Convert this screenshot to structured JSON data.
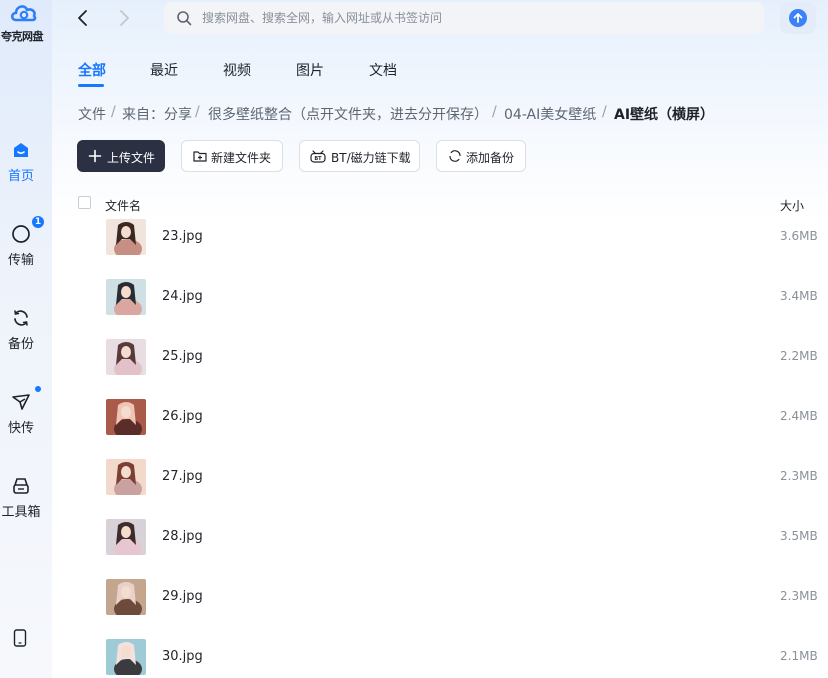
{
  "app": {
    "name": "夸克网盘"
  },
  "colors": {
    "accent": "#1677ff",
    "primary_button": "#2b3042"
  },
  "sidebar": {
    "items": [
      {
        "label": "首页",
        "icon": "home-icon",
        "active": true
      },
      {
        "label": "传输",
        "icon": "transfer-icon",
        "badge": "1"
      },
      {
        "label": "备份",
        "icon": "backup-icon"
      },
      {
        "label": "快传",
        "icon": "quick-send-icon",
        "dot": true
      },
      {
        "label": "工具箱",
        "icon": "toolbox-icon"
      }
    ],
    "bottom_icon": "phone-icon"
  },
  "search": {
    "placeholder": "搜索网盘、搜索全网，输入网址或从书签访问"
  },
  "tabs": [
    {
      "label": "全部",
      "active": true
    },
    {
      "label": "最近"
    },
    {
      "label": "视频"
    },
    {
      "label": "图片"
    },
    {
      "label": "文档"
    }
  ],
  "breadcrumb": {
    "items": [
      "文件",
      "来自：分享",
      "很多壁纸整合（点开文件夹，进去分开保存）",
      "04-AI美女壁纸",
      "AI壁纸（横屏）"
    ],
    "separator": "/"
  },
  "actions": {
    "upload": "上传文件",
    "new_folder": "新建文件夹",
    "bt_download": "BT/磁力链下载",
    "add_backup": "添加备份"
  },
  "table": {
    "col_name": "文件名",
    "col_size": "大小",
    "rows": [
      {
        "name": "23.jpg",
        "size": "3.6MB"
      },
      {
        "name": "24.jpg",
        "size": "3.4MB"
      },
      {
        "name": "25.jpg",
        "size": "2.2MB"
      },
      {
        "name": "26.jpg",
        "size": "2.4MB"
      },
      {
        "name": "27.jpg",
        "size": "2.3MB"
      },
      {
        "name": "28.jpg",
        "size": "3.5MB"
      },
      {
        "name": "29.jpg",
        "size": "2.3MB"
      },
      {
        "name": "30.jpg",
        "size": "2.1MB"
      }
    ]
  }
}
